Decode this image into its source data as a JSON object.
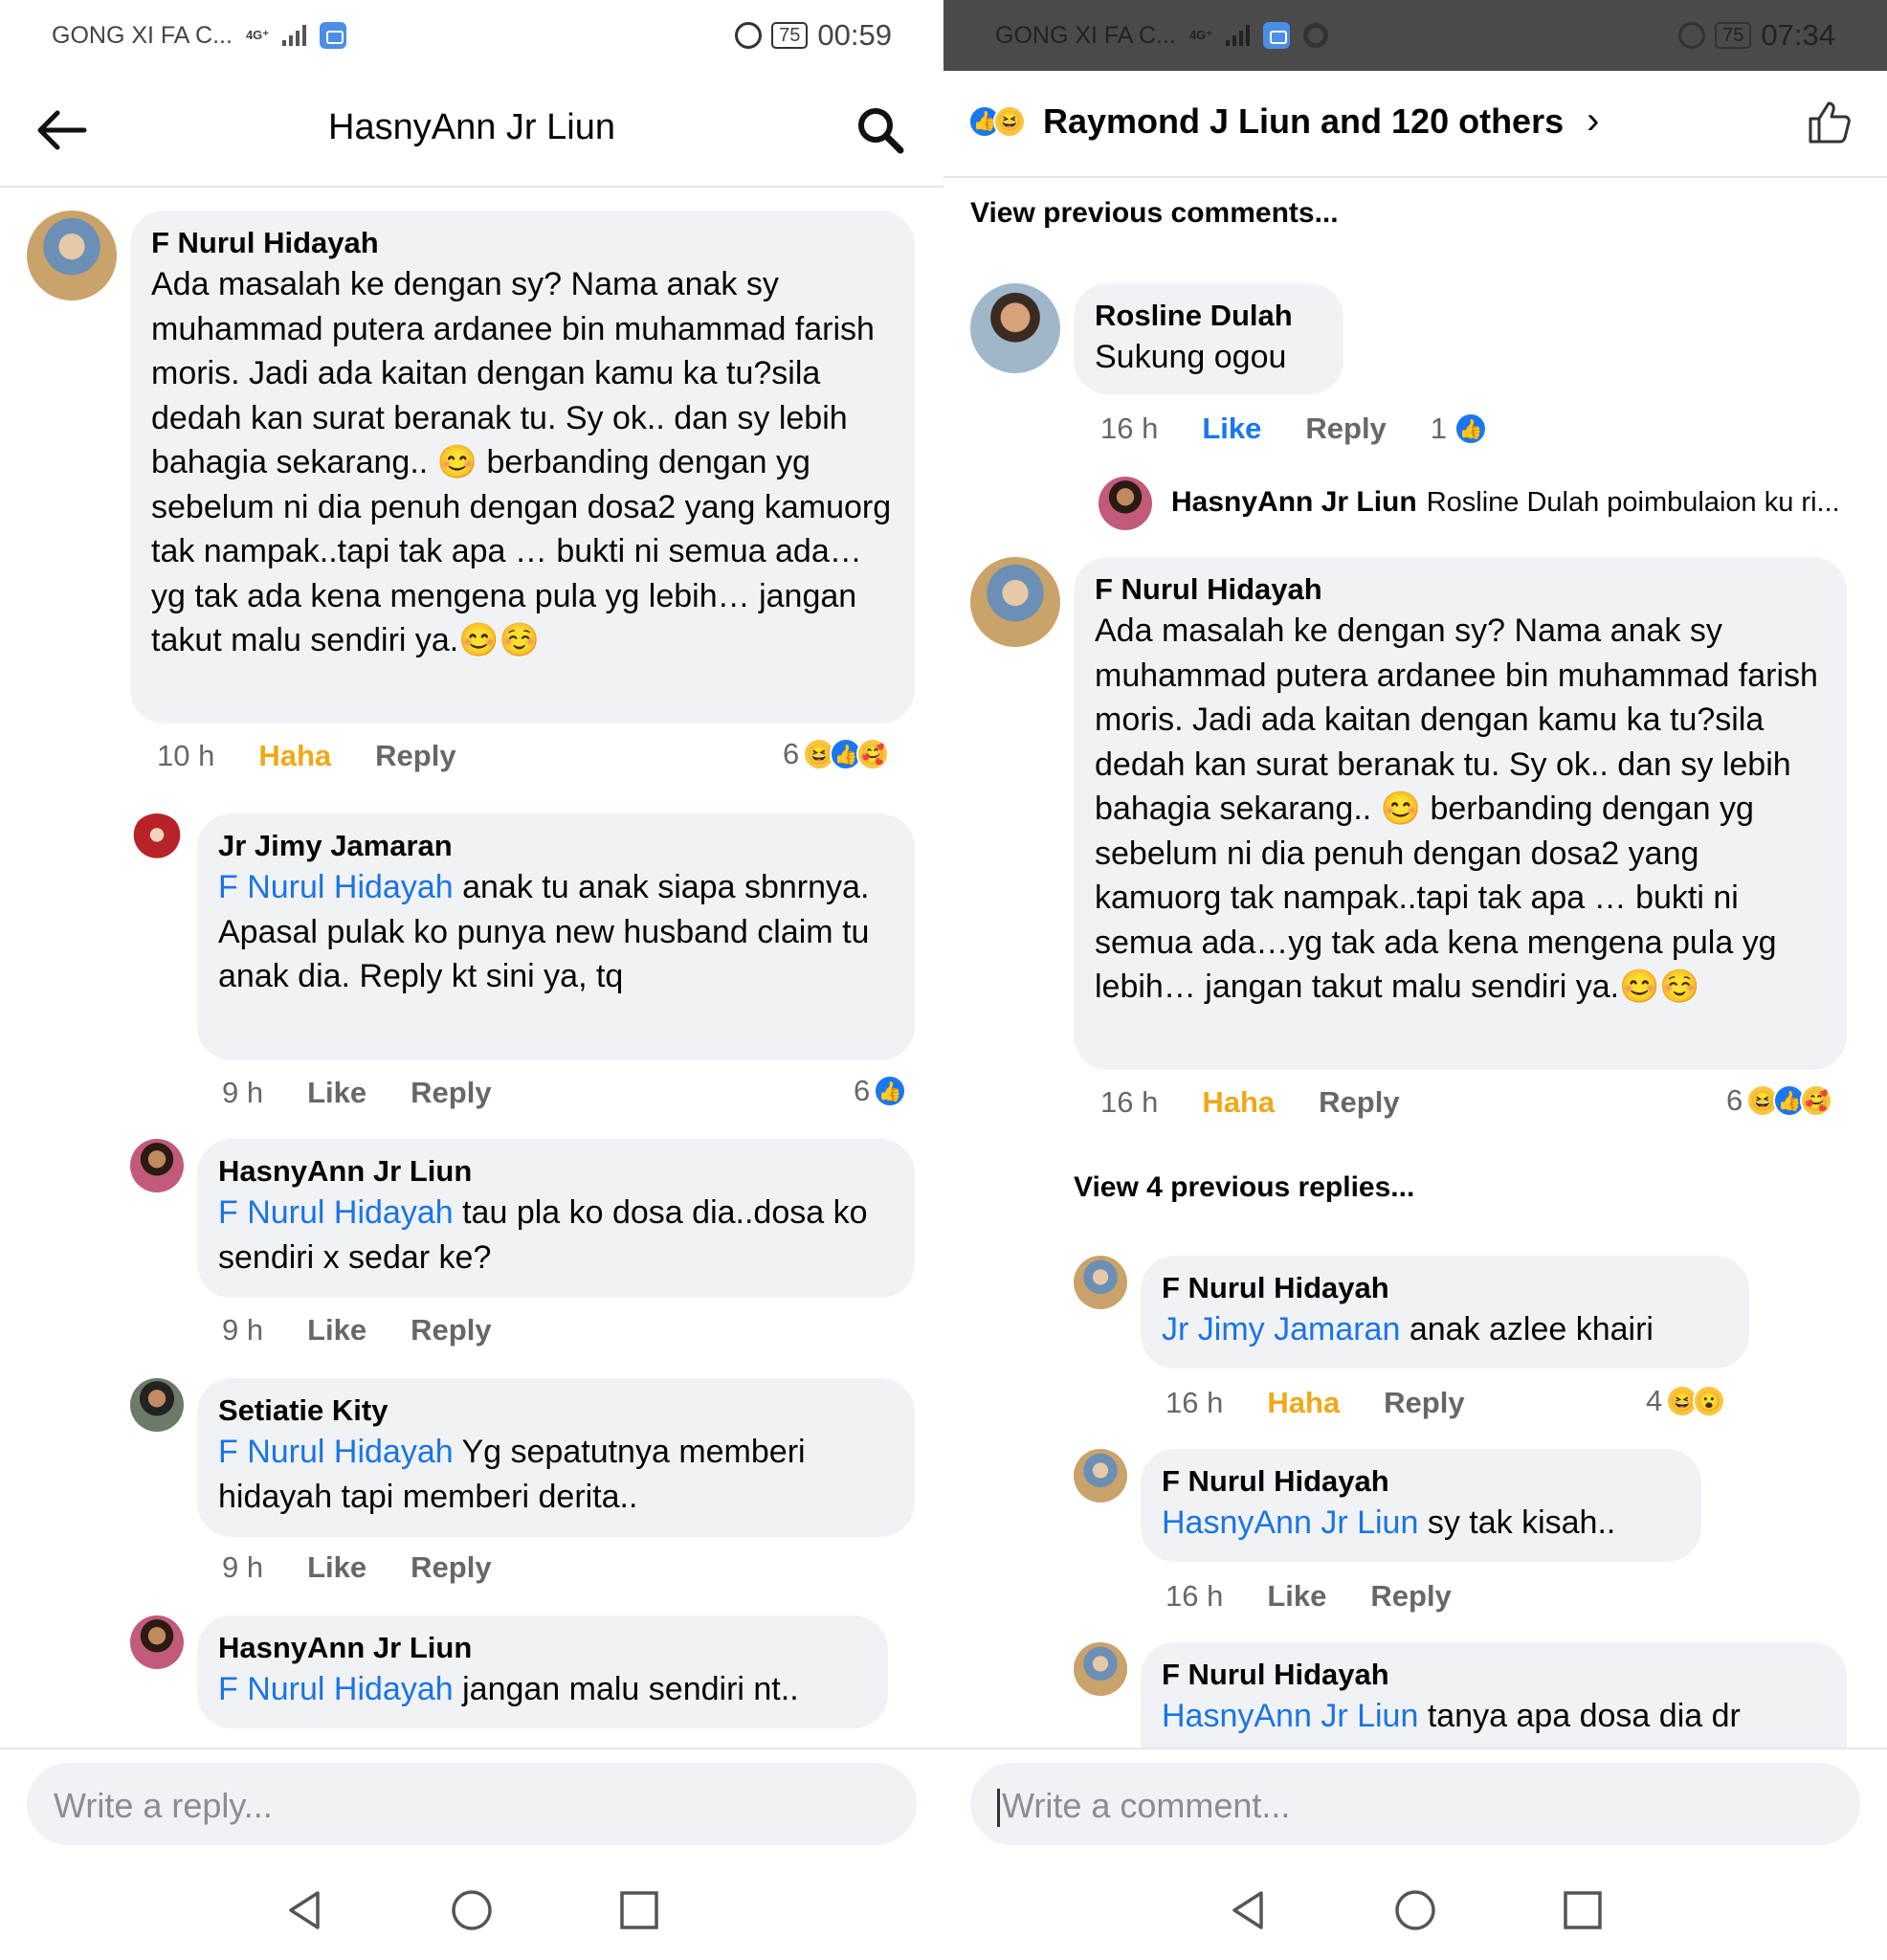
{
  "left": {
    "status": {
      "carrier": "GONG XI FA C...",
      "network": "4G⁺",
      "battery": "75",
      "time": "00:59"
    },
    "header": {
      "title": "HasnyAnn Jr Liun"
    },
    "comments": [
      {
        "name": "F Nurul Hidayah",
        "mention": "",
        "text": "Ada masalah ke dengan sy? Nama anak sy muhammad putera ardanee bin muhammad farish moris. Jadi ada kaitan dengan kamu ka tu?sila dedah kan surat beranak tu. Sy ok.. dan sy lebih bahagia sekarang.. 😊 berbanding dengan yg sebelum ni dia penuh dengan dosa2 yang kamuorg tak nampak..tapi tak apa … bukti ni semua ada…yg tak ada kena mengena pula yg lebih… jangan takut malu sendiri ya.😊☺️",
        "time": "10 h",
        "reaction_label": "Haha",
        "reply_label": "Reply",
        "reaction_count": "6"
      },
      {
        "name": "Jr Jimy Jamaran",
        "mention": "F Nurul Hidayah",
        "text": " anak tu anak siapa sbnrnya. Apasal pulak ko punya new husband claim tu anak dia. Reply kt sini ya, tq",
        "time": "9 h",
        "reaction_label": "Like",
        "reply_label": "Reply",
        "reaction_count": "6"
      },
      {
        "name": "HasnyAnn Jr Liun",
        "mention": "F Nurul Hidayah",
        "text": " tau pla ko dosa dia..dosa ko sendiri x sedar ke?",
        "time": "9 h",
        "reaction_label": "Like",
        "reply_label": "Reply"
      },
      {
        "name": "Setiatie Kity",
        "mention": "F Nurul Hidayah",
        "text": " Yg sepatutnya memberi hidayah tapi memberi derita..",
        "time": "9 h",
        "reaction_label": "Like",
        "reply_label": "Reply"
      },
      {
        "name": "HasnyAnn Jr Liun",
        "mention": "F Nurul Hidayah",
        "text": " jangan malu sendiri nt.."
      }
    ],
    "composer_placeholder": "Write a reply..."
  },
  "right": {
    "status": {
      "carrier": "GONG XI FA C...",
      "network": "4G⁺",
      "battery": "75",
      "time": "07:34"
    },
    "header": {
      "title": "Raymond J Liun and 120 others",
      "chevron": "›"
    },
    "view_previous_comments": "View previous comments...",
    "comments": [
      {
        "name": "Rosline Dulah",
        "text": "Sukung ogou",
        "time": "16 h",
        "reaction_label": "Like",
        "reply_label": "Reply",
        "reaction_count": "1"
      },
      {
        "name": "F Nurul Hidayah",
        "text": "Ada masalah ke dengan sy? Nama anak sy muhammad putera ardanee bin muhammad farish moris. Jadi ada kaitan dengan kamu ka tu?sila dedah kan surat beranak tu. Sy ok.. dan sy lebih bahagia sekarang.. 😊 berbanding dengan yg sebelum ni dia penuh dengan dosa2 yang kamuorg tak nampak..tapi tak apa … bukti ni semua ada…yg tak ada kena mengena pula yg lebih… jangan takut malu sendiri ya.😊☺️",
        "time": "16 h",
        "reaction_label": "Haha",
        "reply_label": "Reply",
        "reaction_count": "6"
      }
    ],
    "reply_preview": {
      "name": "HasnyAnn Jr Liun",
      "text": "Rosline Dulah poimbulaion ku ri..."
    },
    "view_previous_replies": "View 4 previous replies...",
    "replies": [
      {
        "name": "F Nurul Hidayah",
        "mention": "Jr Jimy Jamaran",
        "text": " anak azlee khairi",
        "time": "16 h",
        "reaction_label": "Haha",
        "reply_label": "Reply",
        "reaction_count": "4"
      },
      {
        "name": "F Nurul Hidayah",
        "mention": "HasnyAnn Jr Liun",
        "text": " sy tak kisah..",
        "time": "16 h",
        "reaction_label": "Like",
        "reply_label": "Reply"
      },
      {
        "name": "F Nurul Hidayah",
        "mention": "HasnyAnn Jr Liun",
        "text": " tanya apa dosa dia dr"
      }
    ],
    "composer_placeholder": "Write a comment..."
  },
  "colors": {
    "accent": "#1877f2",
    "mention": "#1b74e4",
    "haha": "#f0a818",
    "bubble": "#f0f2f5",
    "meta": "#65676b"
  },
  "icons": [
    "back-arrow-icon",
    "search-icon",
    "like-reaction-icon",
    "haha-reaction-icon",
    "care-reaction-icon",
    "wow-reaction-icon",
    "thumbs-up-icon",
    "nav-back-icon",
    "nav-home-icon",
    "nav-recents-icon"
  ]
}
